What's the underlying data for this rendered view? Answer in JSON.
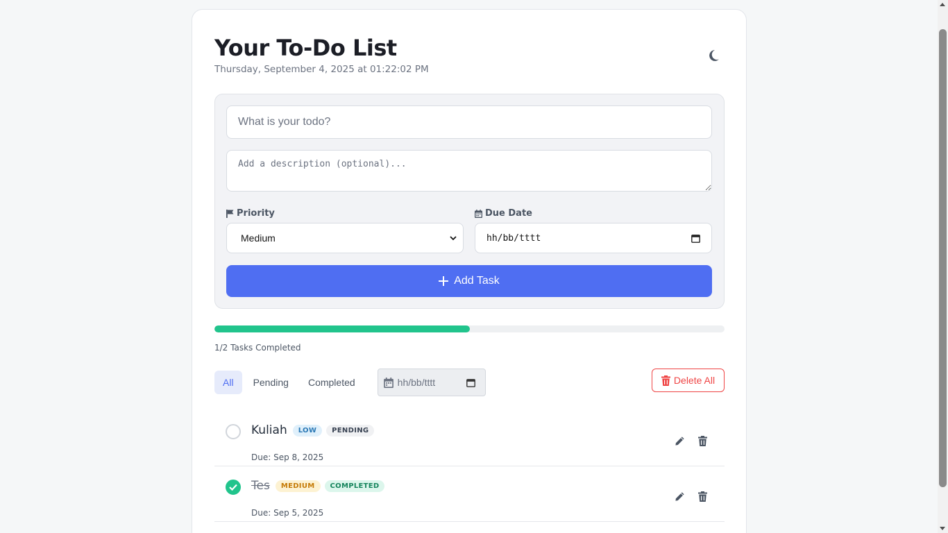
{
  "header": {
    "title": "Your To-Do List",
    "datetime": "Thursday, September 4, 2025 at 01:22:02 PM",
    "theme_icon": "moon-icon"
  },
  "form": {
    "todo_placeholder": "What is your todo?",
    "description_placeholder": "Add a description (optional)...",
    "priority_label": "Priority",
    "priority_icon": "flag-icon",
    "priority_value": "Medium",
    "due_label": "Due Date",
    "due_icon": "calendar-icon",
    "due_value": "hh/bb/tttt",
    "add_label": "Add Task",
    "add_icon": "plus-icon",
    "accent_color": "#4f6ef2"
  },
  "progress": {
    "completed": 1,
    "total": 2,
    "fraction": 0.5,
    "text": "1/2 Tasks Completed",
    "color": "#21c48c"
  },
  "filters": {
    "tabs": [
      {
        "label": "All",
        "active": true
      },
      {
        "label": "Pending",
        "active": false
      },
      {
        "label": "Completed",
        "active": false
      }
    ],
    "date_value": "hh/bb/tttt",
    "delete_all_label": "Delete All",
    "delete_color": "#ef4444"
  },
  "tasks": [
    {
      "title": "Kuliah",
      "completed": false,
      "priority": "LOW",
      "status": "PENDING",
      "due": "Due: Sep 8, 2025"
    },
    {
      "title": "Tes",
      "completed": true,
      "priority": "MEDIUM",
      "status": "COMPLETED",
      "due": "Due: Sep 5, 2025"
    }
  ],
  "badge_colors": {
    "low": {
      "bg": "#e0f0fb",
      "fg": "#2a78b5"
    },
    "medium": {
      "bg": "#fdf2d2",
      "fg": "#c57a06"
    },
    "pending": {
      "bg": "#f0f1f3",
      "fg": "#374151"
    },
    "completed": {
      "bg": "#dcf6ec",
      "fg": "#15845c"
    }
  }
}
